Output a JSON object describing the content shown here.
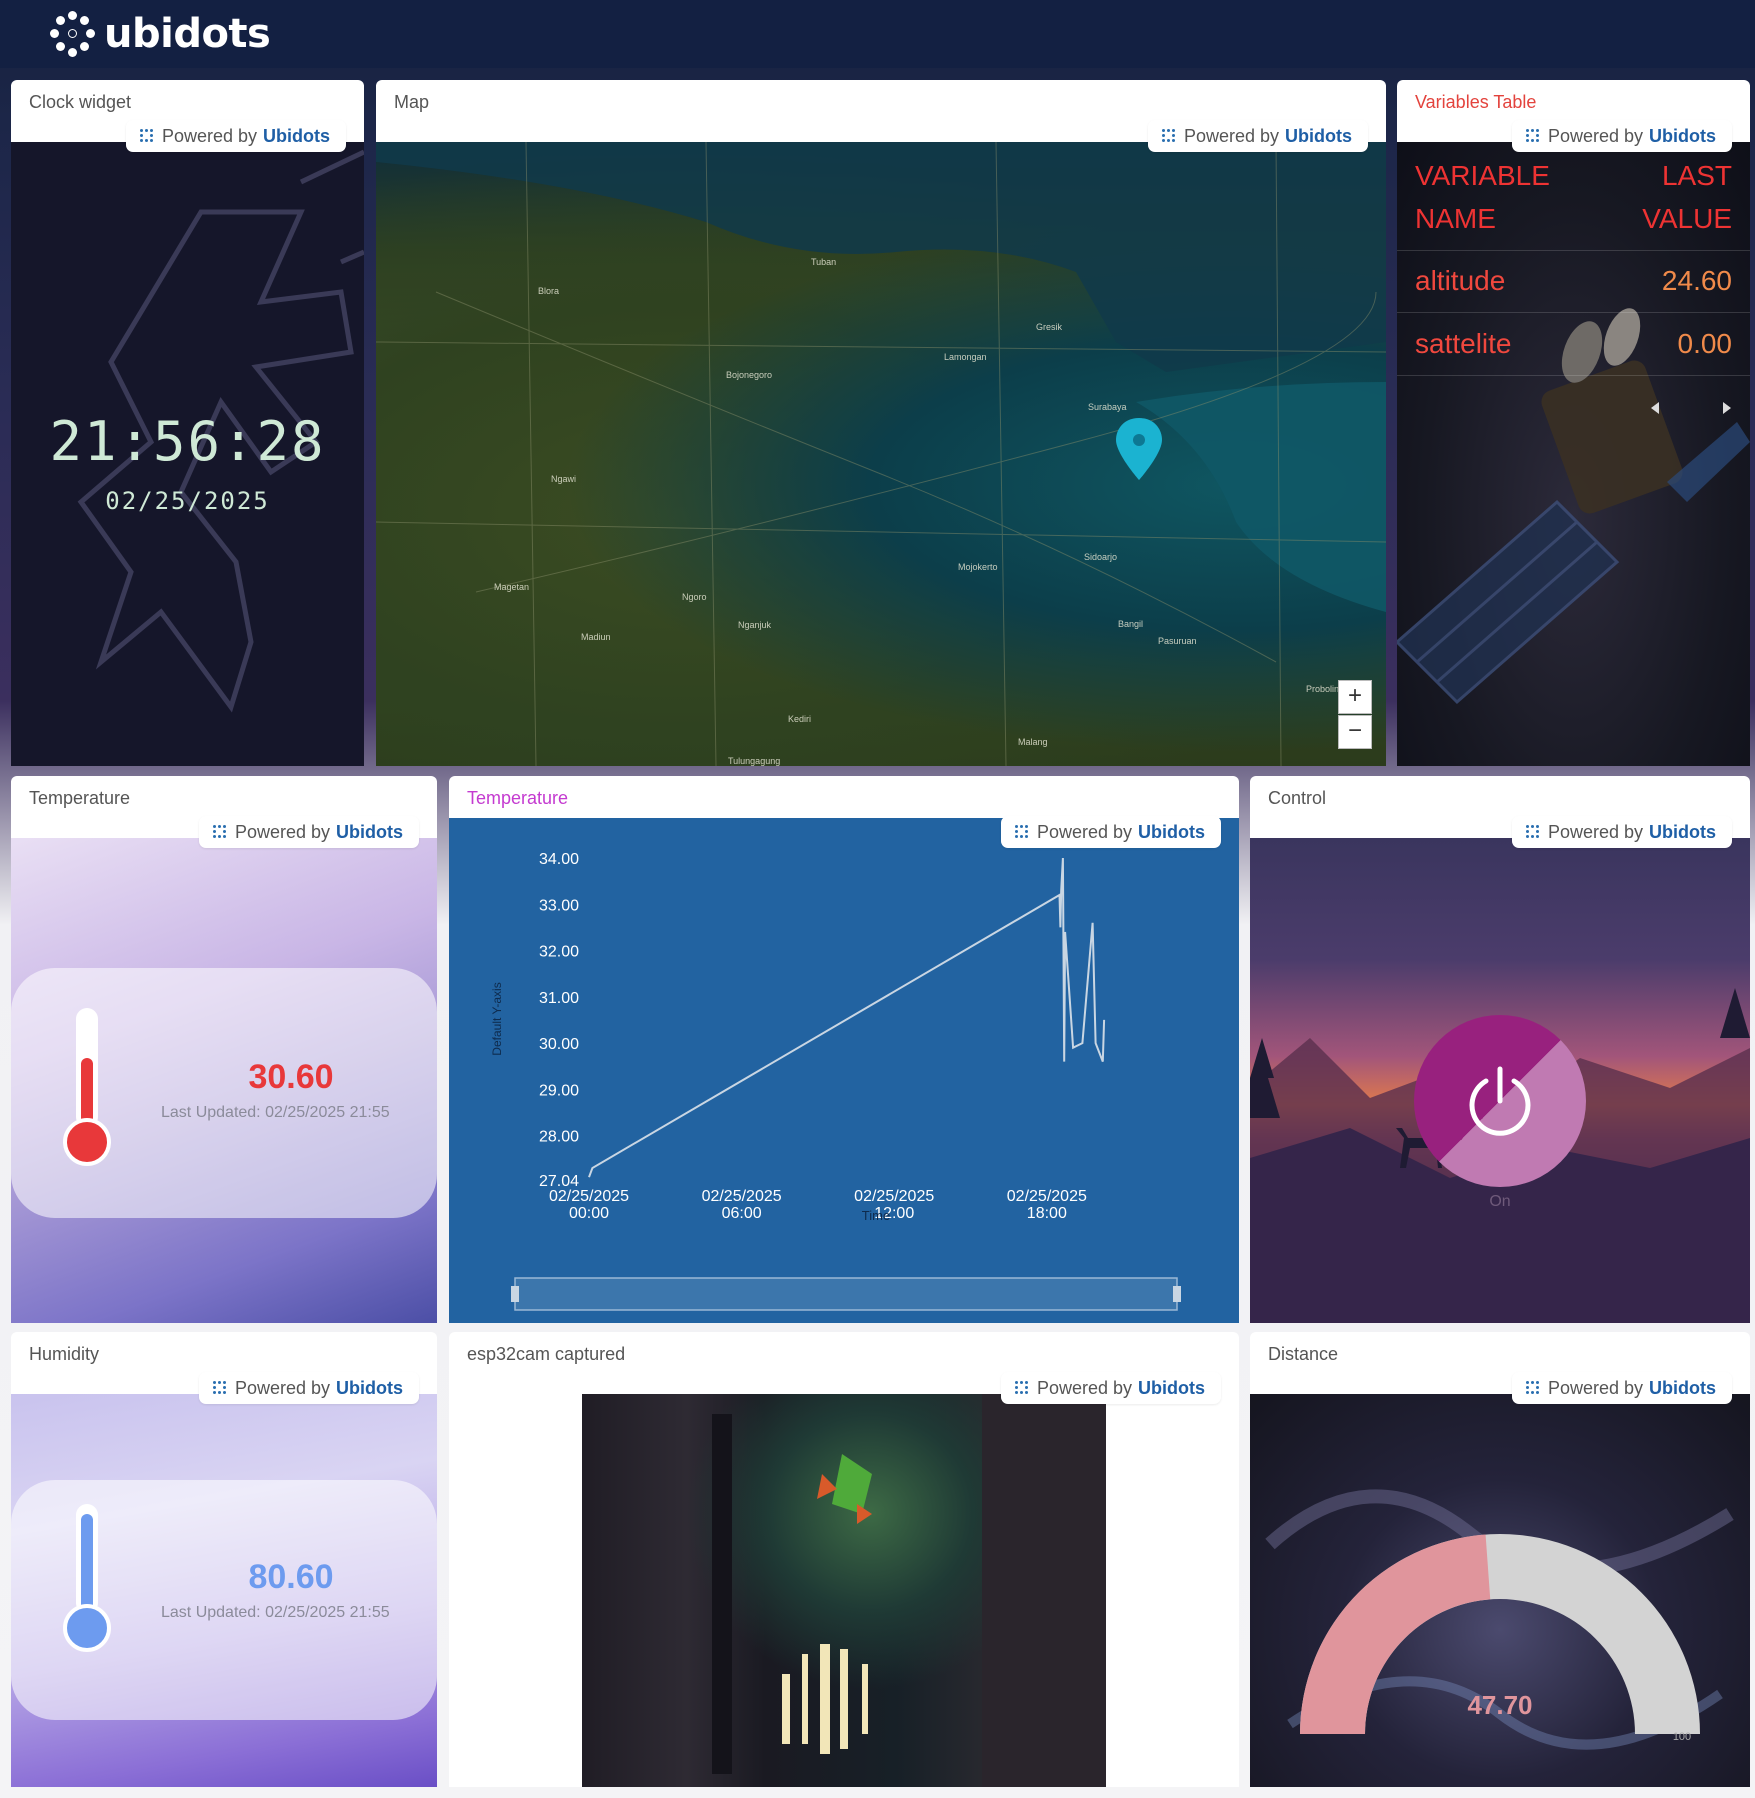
{
  "header": {
    "logo_text": "ubidots"
  },
  "powered": {
    "prefix": "Powered by",
    "brand": "Ubidots"
  },
  "clock": {
    "title": "Clock widget",
    "time": "21:56:28",
    "date": "02/25/2025"
  },
  "map": {
    "title": "Map",
    "zoom_in": "+",
    "zoom_out": "−",
    "place_labels": [
      "Tuban",
      "Bojonegoro",
      "Ngawi",
      "Madiun",
      "Nganjuk",
      "Kediri",
      "Mojokerto",
      "Sidoarjo",
      "Pasuruan",
      "Probolinggo",
      "Malang",
      "Magetan",
      "Ngoro",
      "Bangil",
      "Surabaya",
      "Lamongan",
      "Gresik",
      "Blora",
      "Tulungagung"
    ]
  },
  "variables_table": {
    "title": "Variables Table",
    "col_name": [
      "VARIABLE",
      "NAME"
    ],
    "col_value": [
      "LAST",
      "VALUE"
    ],
    "rows": [
      {
        "name": "altitude",
        "value": "24.60"
      },
      {
        "name": "sattelite",
        "value": "0.00"
      }
    ]
  },
  "temperature_indicator": {
    "title": "Temperature",
    "value": "30.60",
    "last_updated": "Last Updated: 02/25/2025 21:55",
    "color": "#e8383a"
  },
  "humidity_indicator": {
    "title": "Humidity",
    "value": "80.60",
    "last_updated": "Last Updated: 02/25/2025 21:55",
    "color": "#6d9bef"
  },
  "temperature_chart": {
    "title": "Temperature"
  },
  "chart_data": {
    "type": "line",
    "title": "Temperature",
    "xlabel": "Time",
    "ylabel": "Default Y-axis",
    "ylim": [
      27.04,
      34.0
    ],
    "y_ticks": [
      "34.00",
      "33.00",
      "32.00",
      "31.00",
      "30.00",
      "29.00",
      "28.00",
      "27.04"
    ],
    "x_ticks": [
      {
        "date": "02/25/2025",
        "time": "00:00"
      },
      {
        "date": "02/25/2025",
        "time": "06:00"
      },
      {
        "date": "02/25/2025",
        "time": "12:00"
      },
      {
        "date": "02/25/2025",
        "time": "18:00"
      }
    ],
    "xlim": [
      "02/25/2025 00:00",
      "02/25/2025 23:00"
    ],
    "series": [
      {
        "color": "#c9d6e3",
        "points": [
          [
            "02/25/2025 00:00",
            27.1
          ],
          [
            "02/25/2025 00:08",
            27.3
          ],
          [
            "02/25/2025 18:30",
            33.2
          ],
          [
            "02/25/2025 18:32",
            32.5
          ],
          [
            "02/25/2025 18:34",
            33.3
          ],
          [
            "02/25/2025 18:38",
            34.0
          ],
          [
            "02/25/2025 18:41",
            29.6
          ],
          [
            "02/25/2025 18:43",
            32.4
          ],
          [
            "02/25/2025 19:02",
            29.9
          ],
          [
            "02/25/2025 19:24",
            30.0
          ],
          [
            "02/25/2025 19:48",
            32.6
          ],
          [
            "02/25/2025 19:55",
            30.0
          ],
          [
            "02/25/2025 20:12",
            29.6
          ],
          [
            "02/25/2025 20:15",
            30.5
          ]
        ]
      }
    ]
  },
  "control": {
    "title": "Control",
    "state_label": "On"
  },
  "camera": {
    "title": "esp32cam captured"
  },
  "distance": {
    "title": "Distance",
    "value": "47.70",
    "max_label": "100",
    "fraction": 0.477
  },
  "colors": {
    "header_bg": "#132042",
    "brand_blue": "#1f5fa6",
    "control_purple": "#98217e",
    "gauge_fill": "#e0959c"
  }
}
